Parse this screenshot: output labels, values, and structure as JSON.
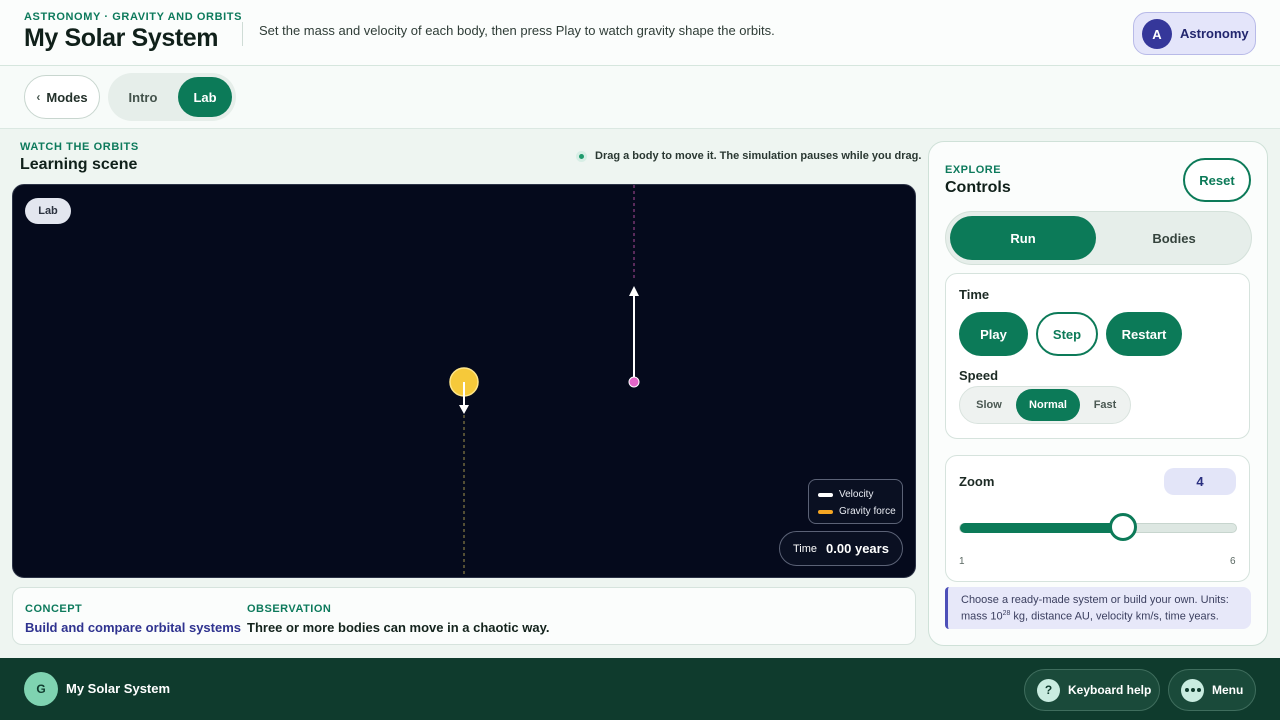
{
  "header": {
    "eyebrow": "ASTRONOMY · GRAVITY AND ORBITS",
    "title": "My Solar System",
    "subtitle": "Set the mass and velocity of each body, then press Play to watch gravity shape the orbits.",
    "badge": {
      "initial": "A",
      "label": "Astronomy"
    }
  },
  "modebar": {
    "modes_label": "Modes",
    "tabs": [
      {
        "label": "Intro",
        "selected": false
      },
      {
        "label": "Lab",
        "selected": true
      }
    ]
  },
  "scene": {
    "eyebrow": "WATCH THE ORBITS",
    "title": "Learning scene",
    "hint": "Drag a body to move it. The simulation pauses while you drag.",
    "chip": "Lab",
    "legend": [
      {
        "label": "Velocity",
        "color": "#ffffff"
      },
      {
        "label": "Gravity force",
        "color": "#f5a623"
      }
    ],
    "time_label": "Time",
    "time_value": "0.00 years",
    "bodies": [
      {
        "name": "star",
        "color": "#f6c93a"
      },
      {
        "name": "planet",
        "color": "#e466c9"
      }
    ]
  },
  "concept": {
    "concept_label": "CONCEPT",
    "concept_text": "Build and compare orbital systems",
    "observation_label": "OBSERVATION",
    "observation_text": "Three or more bodies can move in a chaotic way."
  },
  "controls": {
    "eyebrow": "EXPLORE",
    "title": "Controls",
    "reset_label": "Reset",
    "tabs": [
      {
        "label": "Run",
        "selected": true
      },
      {
        "label": "Bodies",
        "selected": false
      }
    ],
    "time": {
      "label": "Time",
      "play": "Play",
      "step": "Step",
      "restart": "Restart"
    },
    "speed": {
      "label": "Speed",
      "options": [
        "Slow",
        "Normal",
        "Fast"
      ],
      "selected": "Normal"
    },
    "zoom": {
      "label": "Zoom",
      "value": "4",
      "min": "1",
      "max": "6",
      "fraction": 0.59
    },
    "info": {
      "line1": "Choose a ready-made system or build your own. Units:",
      "line2_pre": "mass 10",
      "line2_sup": "28",
      "line2_post": " kg, distance AU, velocity km/s, time years."
    }
  },
  "footer": {
    "avatar": "G",
    "title": "My Solar System",
    "keyboard_help": "Keyboard help",
    "keyboard_icon": "?",
    "menu": "Menu"
  },
  "colors": {
    "accent": "#0c7a58",
    "canvas_bg": "#050a1c",
    "indigo": "#35379a"
  }
}
